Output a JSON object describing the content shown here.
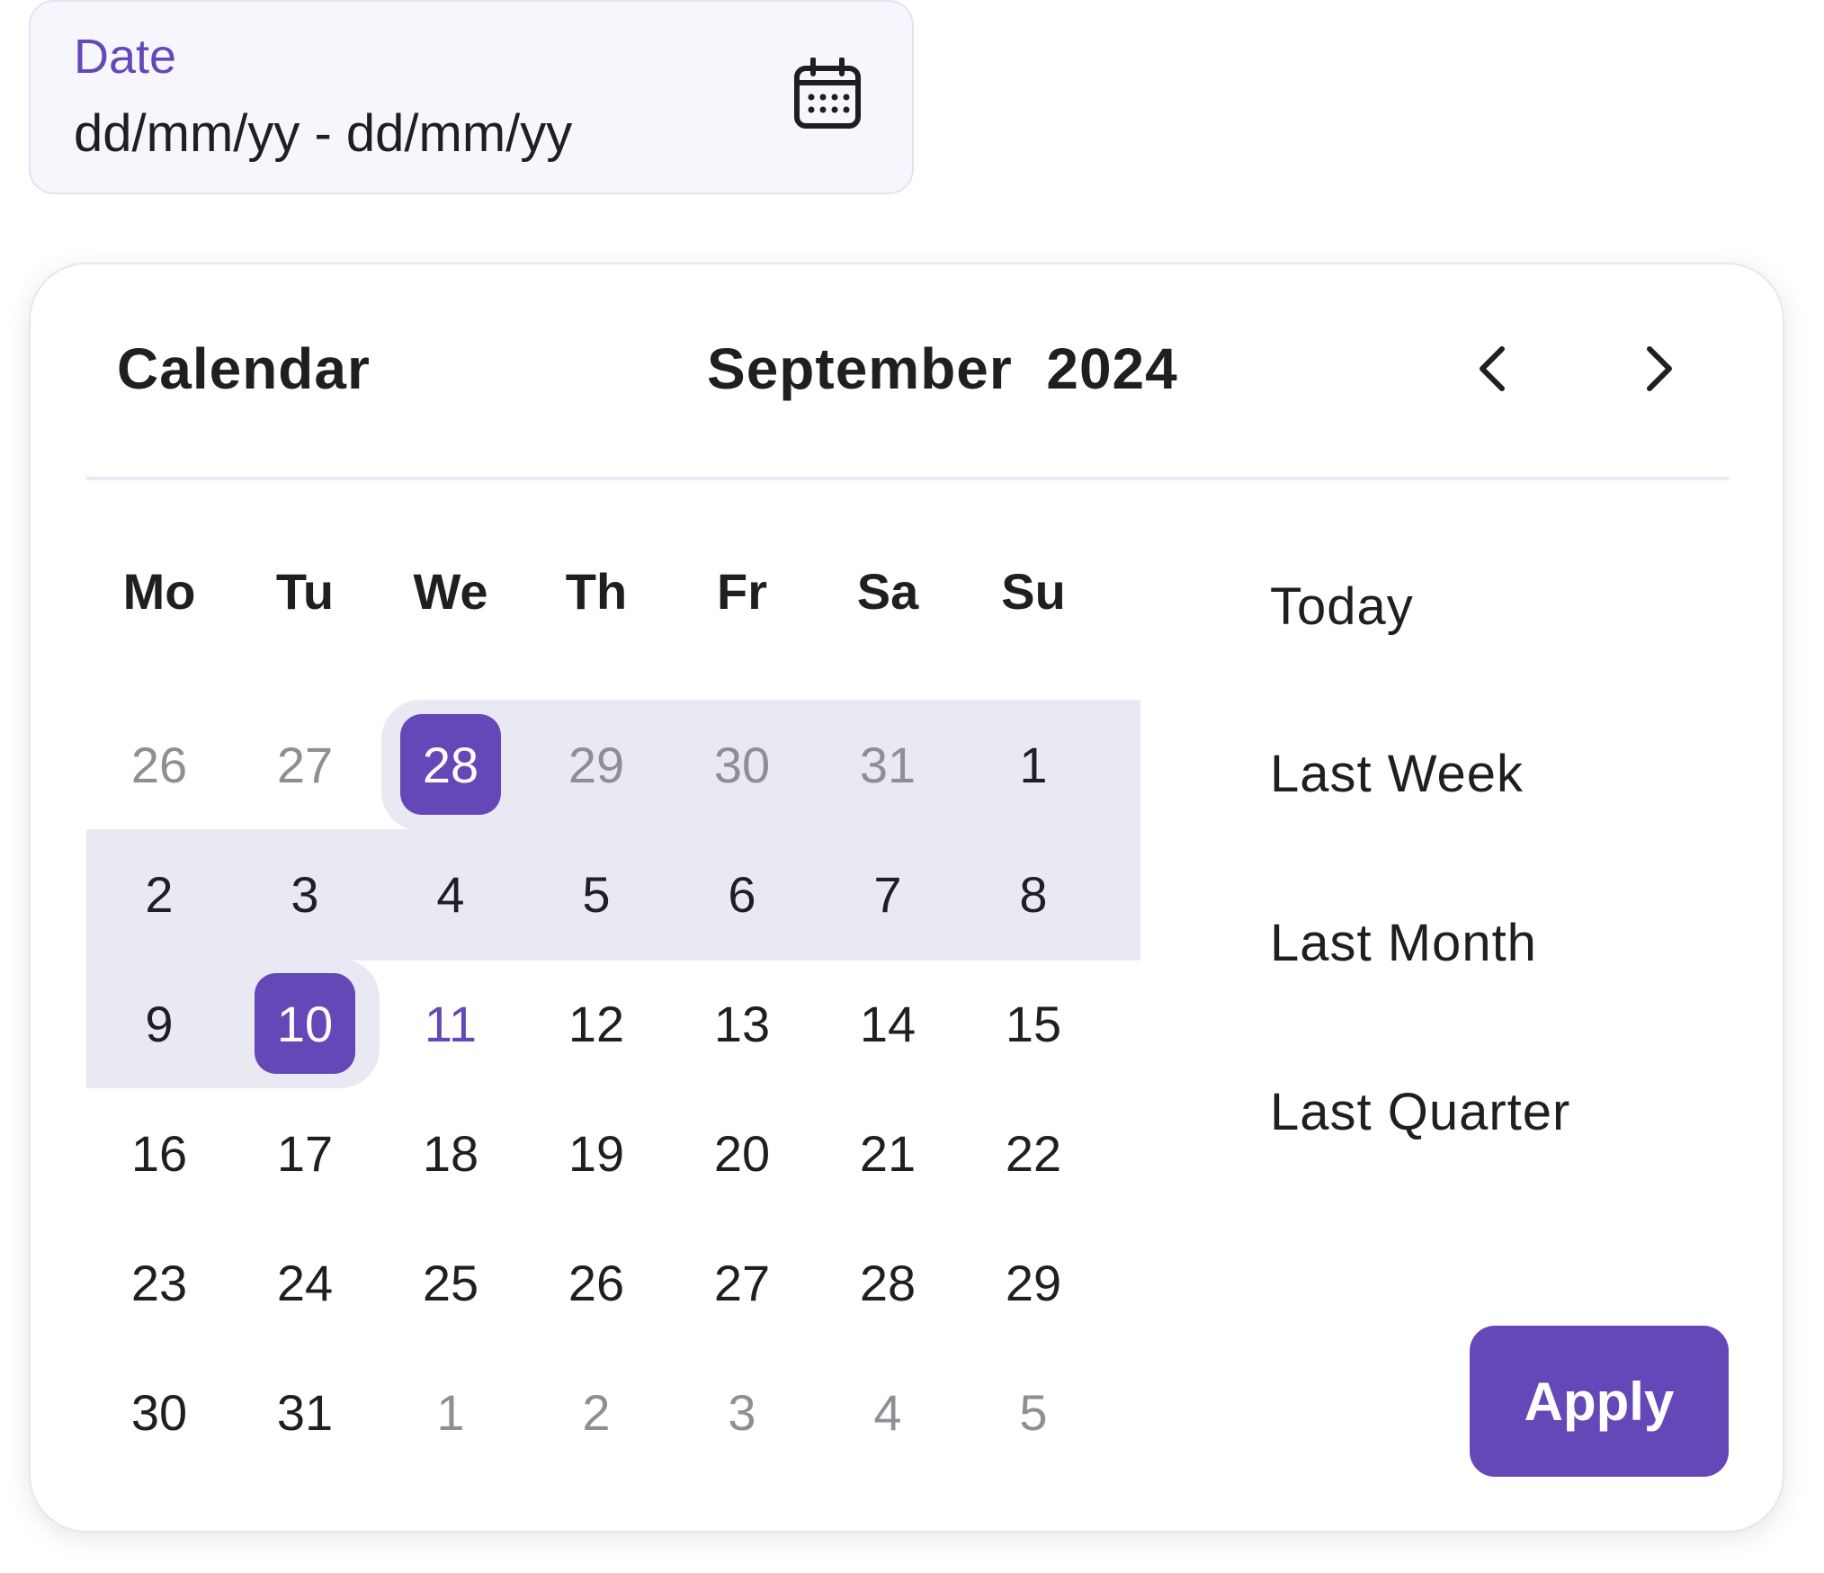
{
  "date_field": {
    "label": "Date",
    "value": "dd/mm/yy - dd/mm/yy",
    "icon": "calendar-icon"
  },
  "calendar": {
    "title": "Calendar",
    "month": "September",
    "year": "2024",
    "prev_icon": "chevron-left-icon",
    "next_icon": "chevron-right-icon",
    "weekdays": [
      "Mo",
      "Tu",
      "We",
      "Th",
      "Fr",
      "Sa",
      "Su"
    ],
    "weeks": [
      [
        "26",
        "27",
        "28",
        "29",
        "30",
        "31",
        "1"
      ],
      [
        "2",
        "3",
        "4",
        "5",
        "6",
        "7",
        "8"
      ],
      [
        "9",
        "10",
        "11",
        "12",
        "13",
        "14",
        "15"
      ],
      [
        "16",
        "17",
        "18",
        "19",
        "20",
        "21",
        "22"
      ],
      [
        "23",
        "24",
        "25",
        "26",
        "27",
        "28",
        "29"
      ],
      [
        "30",
        "31",
        "1",
        "2",
        "3",
        "4",
        "5"
      ]
    ],
    "range_start": "28",
    "range_end": "10",
    "today": "11"
  },
  "presets": [
    "Today",
    "Last Week",
    "Last Month",
    "Last Quarter"
  ],
  "apply_label": "Apply",
  "colors": {
    "accent": "#6548b8",
    "range_fill": "#e8e9f2",
    "field_bg": "#f8f6fd",
    "muted_text": "#8e8e95",
    "text": "#1f1f22"
  }
}
